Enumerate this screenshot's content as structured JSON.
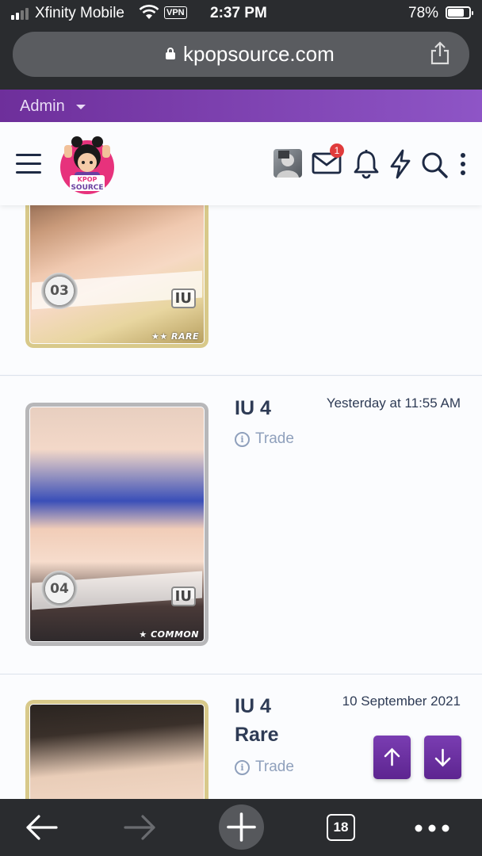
{
  "status_bar": {
    "carrier": "Xfinity Mobile",
    "vpn": "VPN",
    "time": "2:37 PM",
    "battery": "78%",
    "battery_level": 0.78
  },
  "browser": {
    "url": "kpopsource.com",
    "tab_count": "18"
  },
  "admin_bar": {
    "label": "Admin"
  },
  "header": {
    "logo_top": "KPOP",
    "logo_bottom": "SOURCE",
    "message_badge": "1"
  },
  "items": [
    {
      "title": "",
      "date": "",
      "trade": "",
      "card_number": "03",
      "card_idol": "IU",
      "card_rarity": "★★ RARE"
    },
    {
      "title": "IU 4",
      "date": "Yesterday at 11:55 AM",
      "trade": "Trade",
      "card_number": "04",
      "card_idol": "IU",
      "card_rarity": "★ COMMON"
    },
    {
      "title_line1": "IU 4",
      "title_line2": "Rare",
      "date": "10 September 2021",
      "trade": "Trade"
    }
  ],
  "colors": {
    "accent": "#7a3db2",
    "admin_bar": "#8e55c6",
    "text_primary": "#2e3b55",
    "text_muted": "#8fa0bc",
    "badge": "#e03b3b"
  }
}
